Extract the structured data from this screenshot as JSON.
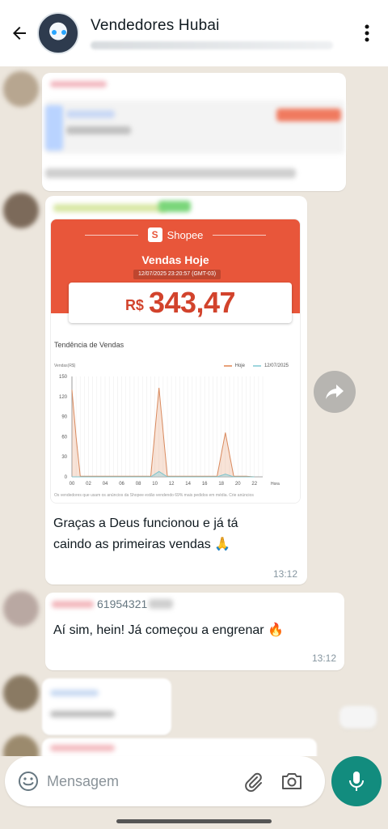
{
  "header": {
    "title": "Vendedores Hubai"
  },
  "messages": [
    {
      "shopee": {
        "brand": "Shopee",
        "heading": "Vendas Hoje",
        "date": "12/07/2025 23:20:57 (GMT-03)",
        "currency": "R$",
        "amount": "343,47",
        "trend_title": "Tendência de Vendas",
        "y_label": "Vendas(R$)",
        "legend_today": "Hoje",
        "legend_date": "12/07/2025",
        "footnote": "Os vendedores que usam os anúncios da Shopee estão vendendo 69% mais pedidos em média. Crie anúncios"
      },
      "text_line1": "Graças a Deus funcionou e já tá",
      "text_line2": "caindo as primeiras vendas 🙏",
      "time": "13:12"
    },
    {
      "phone": "61954321",
      "text": "Aí sim, hein! Já começou a engrenar 🔥",
      "time": "13:12"
    }
  ],
  "composer": {
    "placeholder": "Mensagem"
  },
  "colors": {
    "header_bg": "#ffffff",
    "chat_bg": "#ece6dd",
    "shopee_orange": "#e8563a",
    "mic_green": "#128c7e"
  },
  "chart_data": {
    "type": "area",
    "title": "Tendência de Vendas",
    "ylabel": "Vendas(R$)",
    "xlabel": "Hora",
    "x_ticks": [
      "00",
      "02",
      "04",
      "06",
      "08",
      "10",
      "12",
      "14",
      "16",
      "18",
      "20",
      "22"
    ],
    "y_ticks": [
      "0",
      "30",
      "60",
      "90",
      "120",
      "150"
    ],
    "ylim": [
      0,
      150
    ],
    "xlim": [
      0,
      23
    ],
    "series": [
      {
        "name": "Hoje",
        "color": "#e8a27a",
        "x": [
          0,
          0.5,
          1,
          2,
          4,
          6,
          8,
          9.5,
          10.5,
          11.5,
          12.5,
          14,
          16,
          17.5,
          18.5,
          19.5,
          21,
          22
        ],
        "y": [
          130,
          60,
          1,
          1,
          1,
          1,
          1,
          1,
          133,
          1,
          1,
          1,
          1,
          1,
          66,
          1,
          1,
          0
        ]
      },
      {
        "name": "12/07/2025",
        "color": "#9fd6dd",
        "x": [
          0,
          9.5,
          10.5,
          11.5,
          17.5,
          18.5,
          19.5,
          22
        ],
        "y": [
          0,
          0,
          8,
          0,
          0,
          4,
          0,
          0
        ]
      }
    ],
    "legend": "top-right",
    "grid": true
  }
}
